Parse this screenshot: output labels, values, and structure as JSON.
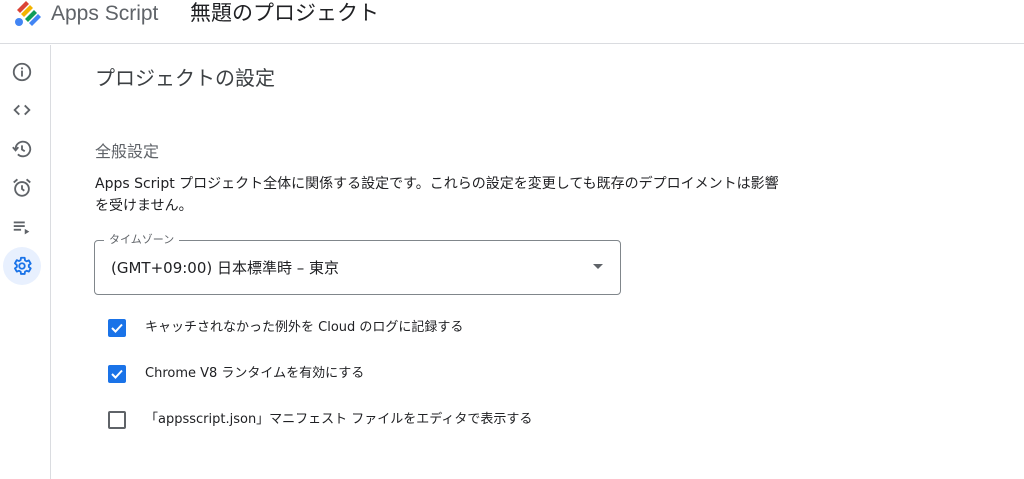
{
  "header": {
    "app_name": "Apps Script",
    "project_title": "無題のプロジェクト",
    "logo_icon": "apps-script-logo"
  },
  "rail": {
    "items": [
      {
        "name": "overview",
        "icon": "info-icon",
        "active": false
      },
      {
        "name": "editor",
        "icon": "code-icon",
        "active": false
      },
      {
        "name": "executions",
        "icon": "history-icon",
        "active": false
      },
      {
        "name": "triggers",
        "icon": "alarm-icon",
        "active": false
      },
      {
        "name": "executions-list",
        "icon": "playlist-icon",
        "active": false
      },
      {
        "name": "settings",
        "icon": "gear-icon",
        "active": true
      }
    ]
  },
  "main": {
    "page_heading": "プロジェクトの設定",
    "section_heading": "全般設定",
    "description": "Apps Script プロジェクト全体に関係する設定です。これらの設定を変更しても既存のデプロイメントは影響を受けません。",
    "timezone": {
      "label": "タイムゾーン",
      "value": "(GMT+09:00) 日本標準時 – 東京"
    },
    "options": [
      {
        "label": "キャッチされなかった例外を Cloud のログに記録する",
        "checked": true
      },
      {
        "label": "Chrome V8 ランタイムを有効にする",
        "checked": true
      },
      {
        "label": "「appsscript.json」マニフェスト ファイルをエディタで表示する",
        "checked": false
      }
    ]
  },
  "colors": {
    "accent": "#1a73e8",
    "active_rail_bg": "#e8f0fe",
    "icon_gray": "#5f6368",
    "divider": "#dadce0"
  }
}
